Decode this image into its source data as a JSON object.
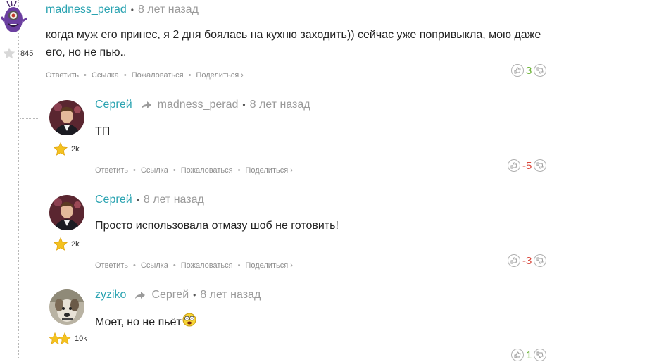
{
  "comments": [
    {
      "author": "madness_perad",
      "reply_to": "",
      "time": "8 лет назад",
      "rating": "845",
      "text": "когда муж его принес, я 2 дня боялась на кухню заходить)) сейчас уже попривыкла, мою даже его, но не пью..",
      "score": "3",
      "avatar": "minion-avatar"
    },
    {
      "author": "Сергей",
      "reply_to": "madness_perad",
      "time": "8 лет назад",
      "rating": "2k",
      "text": "ТП",
      "score": "-5",
      "avatar": "man-avatar"
    },
    {
      "author": "Сергей",
      "reply_to": "",
      "time": "8 лет назад",
      "rating": "2k",
      "text": "Просто использовала отмазу шоб не готовить!",
      "score": "-3",
      "avatar": "man-avatar"
    },
    {
      "author": "zyziko",
      "reply_to": "Сергей",
      "time": "8 лет назад",
      "rating": "10k",
      "text": "Моет, но не пьёт",
      "score": "1",
      "avatar": "dog-avatar"
    }
  ],
  "actions": {
    "reply": "Ответить",
    "link": "Ссылка",
    "report": "Пожаловаться",
    "share": "Поделиться ›"
  },
  "colors": {
    "author": "#2aa3b1",
    "positive": "#6ab234",
    "negative": "#d9463a",
    "meta": "#9a9a9a"
  }
}
